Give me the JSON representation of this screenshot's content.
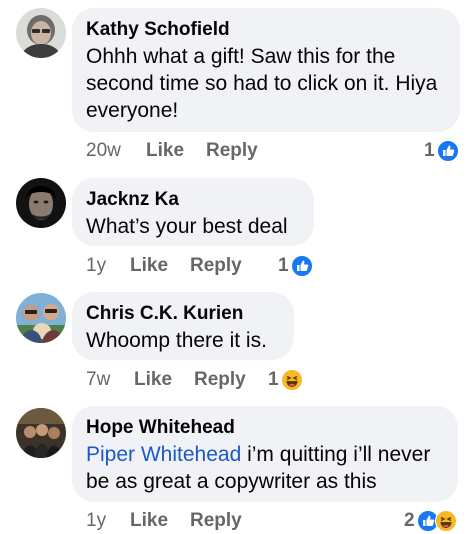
{
  "comments": [
    {
      "name": "Kathy Schofield",
      "text": "Ohhh what a gift! Saw this for the second time so had to click on it. Hiya everyone!",
      "time": "20w",
      "like_label": "Like",
      "reply_label": "Reply",
      "reaction_count": "1",
      "reactions": [
        "like-icon"
      ]
    },
    {
      "name": "Jacknz Ka",
      "text": "What’s your best deal",
      "time": "1y",
      "like_label": "Like",
      "reply_label": "Reply",
      "reaction_count": "1",
      "reactions": [
        "like-icon"
      ]
    },
    {
      "name": "Chris C.K. Kurien",
      "text": "Whoomp there it is.",
      "time": "7w",
      "like_label": "Like",
      "reply_label": "Reply",
      "reaction_count": "1",
      "reactions": [
        "haha-icon"
      ]
    },
    {
      "name": "Hope Whitehead",
      "mention": "Piper Whitehead",
      "text": " i’m quitting i’ll never be as great a copywriter as this",
      "time": "1y",
      "like_label": "Like",
      "reply_label": "Reply",
      "reaction_count": "2",
      "reactions": [
        "like-icon",
        "haha-icon"
      ]
    }
  ],
  "colors": {
    "bubble": "#f0f2f5",
    "like_blue": "#1877f2",
    "mention_blue": "#1b59c7",
    "meta_gray": "#65676b",
    "haha_yellow": "#f7b928"
  }
}
